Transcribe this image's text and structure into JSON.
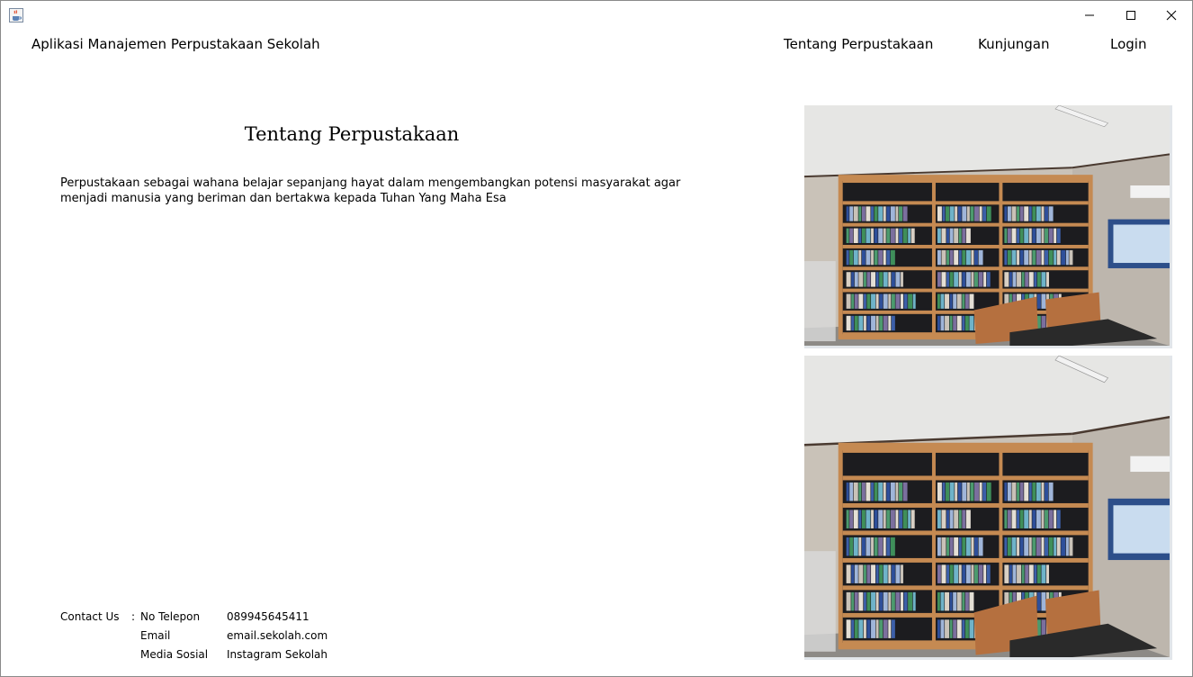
{
  "window": {
    "icon": "java-cup-icon"
  },
  "header": {
    "app_title": "Aplikasi Manajemen Perpustakaan Sekolah",
    "nav": [
      "Tentang Perpustakaan",
      "Kunjungan",
      "Login"
    ]
  },
  "main": {
    "heading": "Tentang Perpustakaan",
    "description": "Perpustakaan sebagai wahana belajar sepanjang hayat dalam mengembangkan potensi masyarakat agar menjadi manusia yang beriman dan bertakwa kepada Tuhan Yang Maha Esa"
  },
  "contact": {
    "label": "Contact Us",
    "separator": ":",
    "rows": [
      {
        "key": "No Telepon",
        "value": "089945645411"
      },
      {
        "key": "Email",
        "value": "email.sekolah.com"
      },
      {
        "key": "Media Sosial",
        "value": "Instagram Sekolah"
      }
    ]
  },
  "images": [
    "library-bookshelf-photo",
    "library-bookshelf-photo"
  ],
  "colors": {
    "background": "#ffffff",
    "border": "#8a8a8a"
  }
}
